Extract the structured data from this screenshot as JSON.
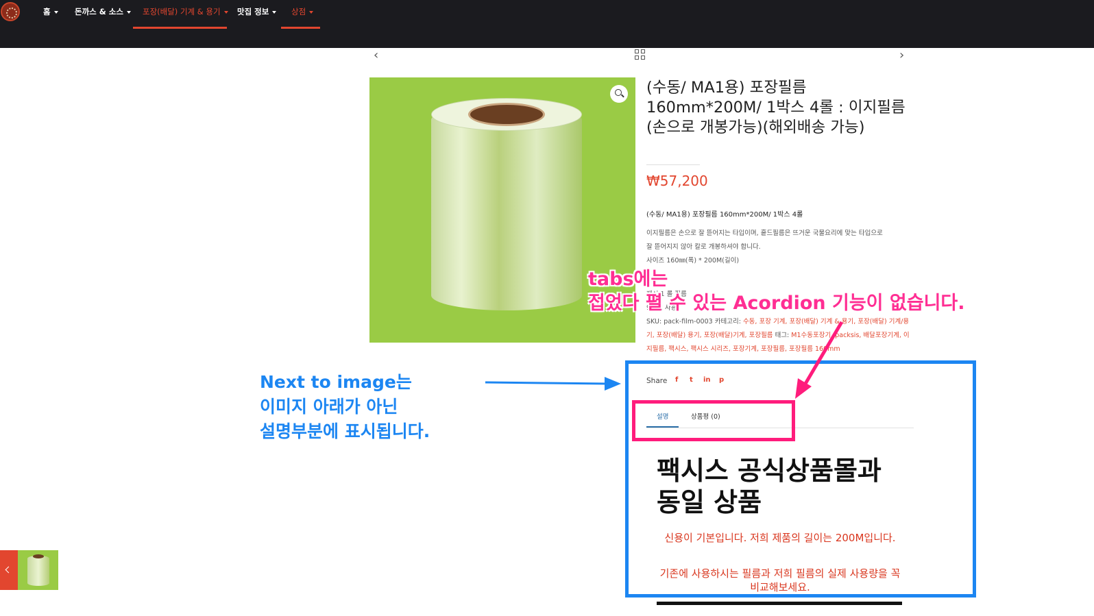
{
  "nav": {
    "items": [
      {
        "label": "홈"
      },
      {
        "label": "돈까스 & 소스"
      },
      {
        "label": "포장(배달) 기계 & 용기"
      },
      {
        "label": "맛집 정보"
      },
      {
        "label": "상점"
      }
    ]
  },
  "product": {
    "title": "(수동/ MA1용) 포장필름 160mm*200M/ 1박스 4롤 : 이지필름(손으로 개봉가능)(해외배송 가능)",
    "price": "₩57,200",
    "short_title": "(수동/ MA1용) 포장필름 160mm*200M/ 1박스 4롤",
    "description_lines": [
      "이지필름은 손으로 잘 뜯어지는 타입이며, 홑드필름은 뜨거운 국물요리에 맞는 타입으로",
      "잘 뜯어지지 않아 칼로 개봉하셔야 합니다.",
      "사이즈  160㎜(폭) * 200M(길이)",
      "5",
      "재시      1 롤 필름",
      "91       시 사용"
    ],
    "sku_label": "SKU:",
    "sku": "pack-film-0003",
    "category_label": "카테고리:",
    "categories": "수동, 포장 기계, 포장(배달) 기계 & 용기, 포장(배달) 기계/용기, 포장(배달) 용기, 포장(배달)기계, 포장필름",
    "tag_label": "태그:",
    "tags": "M1수동포장기, packsis, 배달포장기계, 이지필름, 팩시스, 팩시스 시리즈, 포장기계, 포장필름, 포장필름 160mm"
  },
  "share": {
    "label": "Share",
    "icons": [
      "f",
      "t",
      "in",
      "p"
    ]
  },
  "tabs": [
    {
      "label": "설명"
    },
    {
      "label": "상품평 (0)"
    }
  ],
  "description": {
    "heading": "팩시스 공식상품몰과 동일 상품",
    "red_lines": [
      "신용이 기본입니다. 저희 제품의 길이는 200M입니다.",
      "기존에 사용하시는 필름과 저희 필름의 실제 사용량을 꼭 비교해보세요."
    ]
  },
  "annotations": {
    "pink_line1": "tabs에는",
    "pink_line2": "접었다 펼 수 있는 Acordion 기능이 없습니다.",
    "blue_line1": "Next to image는",
    "blue_line2": "이미지 아래가 아닌",
    "blue_line3": "설명부분에 표시됩니다."
  },
  "colors": {
    "accent": "#e2462f",
    "topbar": "#1b1b1f",
    "annotation_pink": "#ff2e93",
    "annotation_blue": "#1c86f2"
  }
}
